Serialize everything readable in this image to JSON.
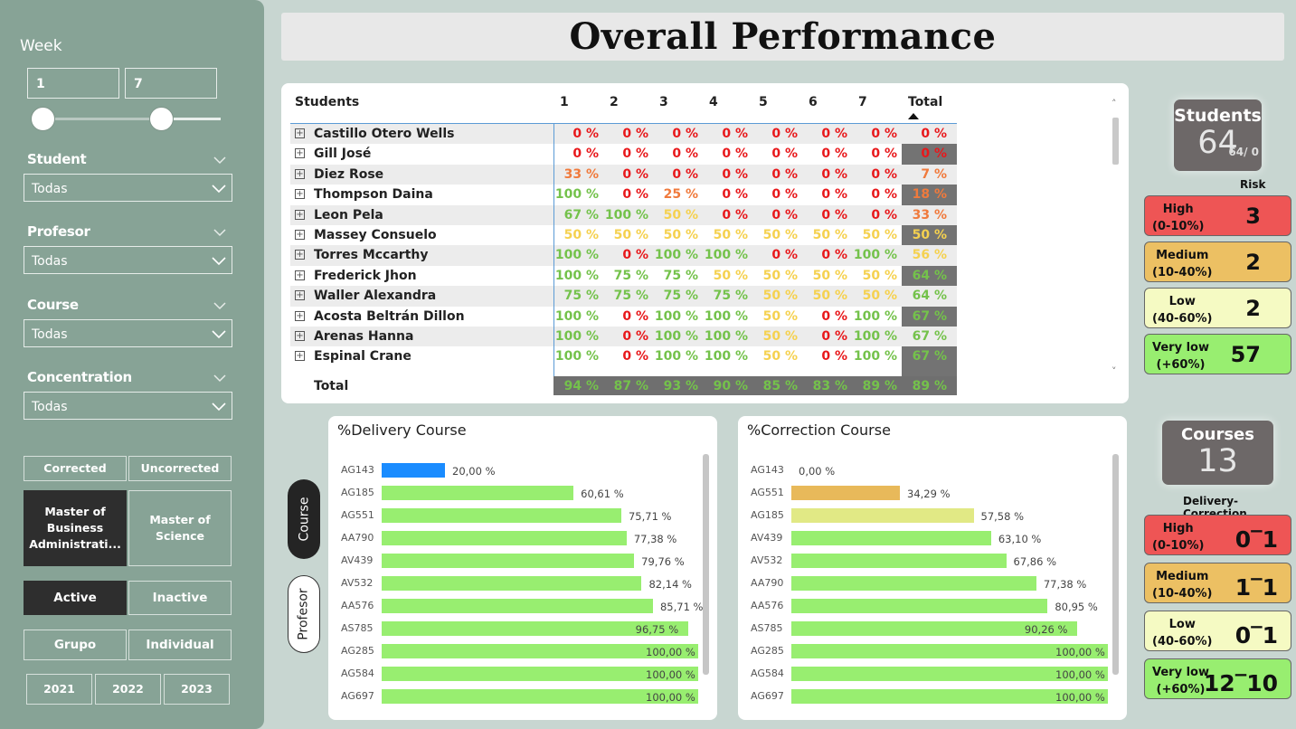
{
  "title": "Overall Performance",
  "filters": {
    "week_label": "Week",
    "week_from": "1",
    "week_to": "7",
    "student": {
      "label": "Student",
      "value": "Todas"
    },
    "profesor": {
      "label": "Profesor",
      "value": "Todas"
    },
    "course": {
      "label": "Course",
      "value": "Todas"
    },
    "concentration": {
      "label": "Concentration",
      "value": "Todas"
    }
  },
  "buttons": {
    "corrected": "Corrected",
    "uncorrected": "Uncorrected",
    "mba": "Master of Business Administrati...",
    "ms": "Master of Science",
    "active": "Active",
    "inactive": "Inactive",
    "grupo": "Grupo",
    "individual": "Individual",
    "y2021": "2021",
    "y2022": "2022",
    "y2023": "2023"
  },
  "matrix": {
    "headers": [
      "Students",
      "1",
      "2",
      "3",
      "4",
      "5",
      "6",
      "7",
      "Total"
    ],
    "rows": [
      {
        "name": "Castillo Otero Wells",
        "vals": [
          "0 %",
          "0 %",
          "0 %",
          "0 %",
          "0 %",
          "0 %",
          "0 %",
          "0 %"
        ]
      },
      {
        "name": "Gill José",
        "vals": [
          "0 %",
          "0 %",
          "0 %",
          "0 %",
          "0 %",
          "0 %",
          "0 %",
          "0 %"
        ]
      },
      {
        "name": "Diez Rose",
        "vals": [
          "33 %",
          "0 %",
          "0 %",
          "0 %",
          "0 %",
          "0 %",
          "0 %",
          "7 %"
        ]
      },
      {
        "name": "Thompson Daina",
        "vals": [
          "100 %",
          "0 %",
          "25 %",
          "0 %",
          "0 %",
          "0 %",
          "0 %",
          "18 %"
        ]
      },
      {
        "name": "Leon Pela",
        "vals": [
          "67 %",
          "100 %",
          "50 %",
          "0 %",
          "0 %",
          "0 %",
          "0 %",
          "33 %"
        ]
      },
      {
        "name": "Massey Consuelo",
        "vals": [
          "50 %",
          "50 %",
          "50 %",
          "50 %",
          "50 %",
          "50 %",
          "50 %",
          "50 %"
        ]
      },
      {
        "name": "Torres Mccarthy",
        "vals": [
          "100 %",
          "0 %",
          "100 %",
          "100 %",
          "0 %",
          "0 %",
          "100 %",
          "56 %"
        ]
      },
      {
        "name": "Frederick Jhon",
        "vals": [
          "100 %",
          "75 %",
          "75 %",
          "50 %",
          "50 %",
          "50 %",
          "50 %",
          "64 %"
        ]
      },
      {
        "name": "Waller Alexandra",
        "vals": [
          "75 %",
          "75 %",
          "75 %",
          "75 %",
          "50 %",
          "50 %",
          "50 %",
          "64 %"
        ]
      },
      {
        "name": "Acosta Beltrán Dillon",
        "vals": [
          "100 %",
          "0 %",
          "100 %",
          "100 %",
          "50 %",
          "0 %",
          "100 %",
          "67 %"
        ]
      },
      {
        "name": "Arenas Hanna",
        "vals": [
          "100 %",
          "0 %",
          "100 %",
          "100 %",
          "50 %",
          "0 %",
          "100 %",
          "67 %"
        ]
      },
      {
        "name": "Espinal Crane",
        "vals": [
          "100 %",
          "0 %",
          "100 %",
          "100 %",
          "50 %",
          "0 %",
          "100 %",
          "67 %"
        ]
      }
    ],
    "total_label": "Total",
    "totals": [
      "94 %",
      "87 %",
      "93 %",
      "90 %",
      "85 %",
      "83 %",
      "89 %",
      "89 %"
    ]
  },
  "students_kpi": {
    "title": "Students",
    "value": "64",
    "sub": "64/ 0",
    "risk_label": "Risk"
  },
  "risk": [
    {
      "name": "High",
      "range": "(0-10%)",
      "value": "3",
      "color": "#ee5555"
    },
    {
      "name": "Medium",
      "range": "(10-40%)",
      "value": "2",
      "color": "#ecc063"
    },
    {
      "name": "Low",
      "range": "(40-60%)",
      "value": "2",
      "color": "#f5fac3"
    },
    {
      "name": "Very low",
      "range": "(+60%)",
      "value": "57",
      "color": "#98ee70"
    }
  ],
  "courses_kpi": {
    "title": "Courses",
    "value": "13",
    "risk_label": "Delivery-Correction"
  },
  "course_risk": [
    {
      "name": "High",
      "range": "(0-10%)",
      "value": "0‾1",
      "color": "#ee5555"
    },
    {
      "name": "Medium",
      "range": "(10-40%)",
      "value": "1‾1",
      "color": "#ecc063"
    },
    {
      "name": "Low",
      "range": "(40-60%)",
      "value": "0‾1",
      "color": "#f5fac3"
    },
    {
      "name": "Very low",
      "range": "(+60%)",
      "value": "12‾10",
      "color": "#98ee70"
    }
  ],
  "toggles": {
    "course": "Course",
    "profesor": "Profesor"
  },
  "colors": {
    "green": "#98ee70",
    "blue": "#1a8cff",
    "orange": "#e8b95a",
    "yellow": "#e1e985"
  },
  "chart_data": [
    {
      "type": "bar",
      "title": "%Delivery Course",
      "categories": [
        "AG143",
        "AG185",
        "AG551",
        "AA790",
        "AV439",
        "AV532",
        "AA576",
        "AS785",
        "AG285",
        "AG584",
        "AG697"
      ],
      "values": [
        20.0,
        60.61,
        75.71,
        77.38,
        79.76,
        82.14,
        85.71,
        96.75,
        100.0,
        100.0,
        100.0
      ],
      "labels": [
        "20,00 %",
        "60,61 %",
        "75,71 %",
        "77,38 %",
        "79,76 %",
        "82,14 %",
        "85,71 %",
        "96,75 %",
        "100,00 %",
        "100,00 %",
        "100,00 %"
      ],
      "colors": [
        "#1a8cff",
        "#98ee70",
        "#98ee70",
        "#98ee70",
        "#98ee70",
        "#98ee70",
        "#98ee70",
        "#98ee70",
        "#98ee70",
        "#98ee70",
        "#98ee70"
      ],
      "xlim": [
        0,
        100
      ]
    },
    {
      "type": "bar",
      "title": "%Correction Course",
      "categories": [
        "AG143",
        "AG551",
        "AG185",
        "AV439",
        "AV532",
        "AA790",
        "AA576",
        "AS785",
        "AG285",
        "AG584",
        "AG697"
      ],
      "values": [
        0.0,
        34.29,
        57.58,
        63.1,
        67.86,
        77.38,
        80.95,
        90.26,
        100.0,
        100.0,
        100.0
      ],
      "labels": [
        "0,00 %",
        "34,29 %",
        "57,58 %",
        "63,10 %",
        "67,86 %",
        "77,38 %",
        "80,95 %",
        "90,26 %",
        "100,00 %",
        "100,00 %",
        "100,00 %"
      ],
      "colors": [
        "#98ee70",
        "#e8b95a",
        "#e1e985",
        "#98ee70",
        "#98ee70",
        "#98ee70",
        "#98ee70",
        "#98ee70",
        "#98ee70",
        "#98ee70",
        "#98ee70"
      ],
      "xlim": [
        0,
        100
      ]
    }
  ]
}
